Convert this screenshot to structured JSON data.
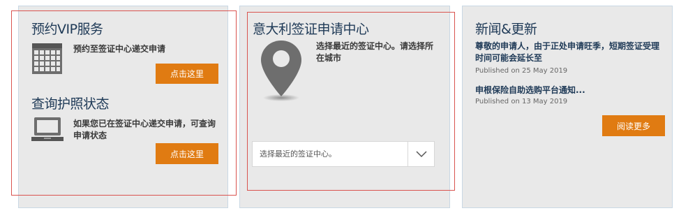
{
  "appointment": {
    "title": "预约VIP服务",
    "description": "预约至签证中心递交申请",
    "button_label": "点击这里",
    "icon": "calendar-icon"
  },
  "passport": {
    "title": "查询护照状态",
    "description": "如果您已在签证中心递交申请，可查询申请状态",
    "button_label": "点击这里",
    "icon": "laptop-icon"
  },
  "center": {
    "title": "意大利签证申请中心",
    "description": "选择最近的签证中心。请选择所在城市",
    "select_value": "选择最近的签证中心。",
    "icon": "map-pin-icon"
  },
  "news": {
    "title": "新闻&更新",
    "items": [
      {
        "title": "尊敬的申请人，由于正处申请旺季，短期签证受理时间可能会延长至",
        "date": "Published on 25 May 2019"
      },
      {
        "title": "申根保险自助选购平台通知...",
        "date": "Published on 13 May 2019"
      }
    ],
    "button_label": "阅读更多"
  },
  "colors": {
    "accent": "#e07b12",
    "panel": "#e9e9e9",
    "title": "#1f3a57",
    "highlight": "#d9534f"
  }
}
